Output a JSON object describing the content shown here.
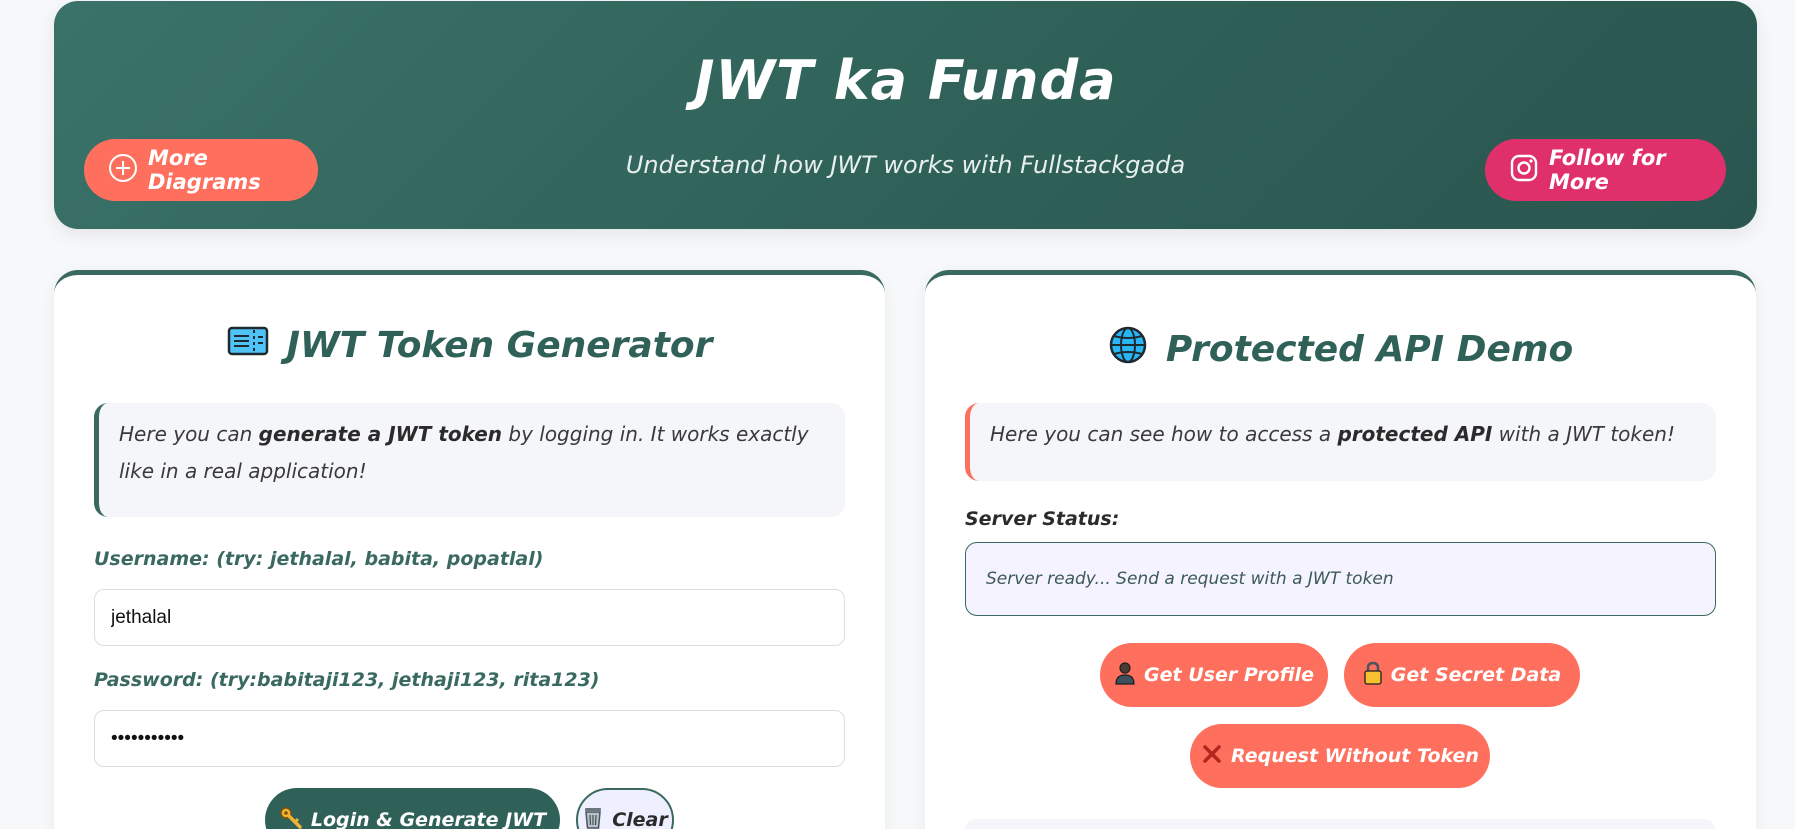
{
  "header": {
    "title": "JWT ka Funda",
    "subtitle": "Understand how JWT works with Fullstackgada",
    "more_label": "More Diagrams",
    "follow_label": "Follow for More"
  },
  "generator": {
    "title": "JWT Token Generator",
    "info_pre": "Here you can ",
    "info_bold": "generate a JWT token",
    "info_post": " by logging in. It works exactly like in a real application!",
    "username_label": "Username: (try: jethalal, babita, popatlal)",
    "username_value": "jethalal",
    "password_label": "Password: (try:babitaji123, jethaji123, rita123)",
    "password_value": "jethaji1234",
    "login_label": "Login & Generate JWT",
    "clear_label": "Clear"
  },
  "api": {
    "title": "Protected API Demo",
    "info_pre": "Here you can see how to access a ",
    "info_bold": "protected API",
    "info_post": " with a JWT token!",
    "status_label": "Server Status:",
    "status_text": "Server ready... Send a request with a JWT token",
    "profile_label": "Get User Profile",
    "secret_label": "Get Secret Data",
    "no_token_label": "Request Without Token"
  },
  "icons": {
    "more": "plus-circle-icon",
    "follow": "instagram-icon",
    "generator": "ticket-icon",
    "api": "globe-icon",
    "login": "key-icon",
    "clear": "trash-icon",
    "profile": "person-icon",
    "secret": "lock-icon",
    "no_token": "cross-icon"
  },
  "colors": {
    "primary": "#2f6158",
    "accent": "#fe6f5e",
    "instagram": "#e0306b"
  }
}
